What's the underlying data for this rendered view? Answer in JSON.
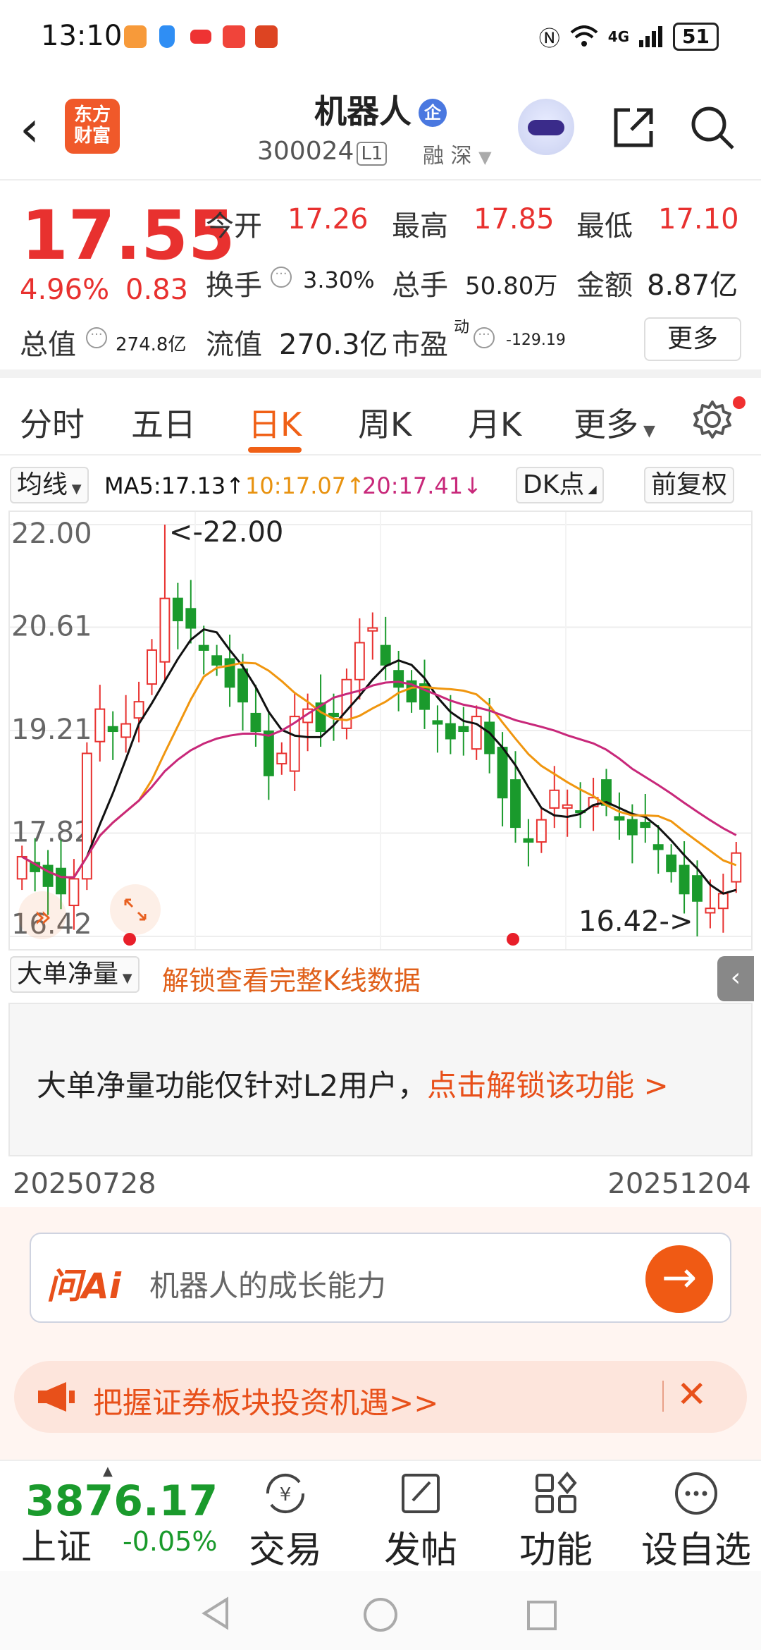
{
  "status_bar": {
    "time": "13:10",
    "network": "4G",
    "battery": "51"
  },
  "header": {
    "app_logo": "东方财富",
    "title": "机器人",
    "title_badge": "企",
    "code": "300024",
    "level_tag": "L1",
    "market_tags": "融 深"
  },
  "quote": {
    "price": "17.55",
    "change_pct": "4.96%",
    "change": "0.83",
    "open_label": "今开",
    "open": "17.26",
    "high_label": "最高",
    "high": "17.85",
    "low_label": "最低",
    "low": "17.10",
    "turnover_label": "换手",
    "turnover": "3.30%",
    "volume_label": "总手",
    "volume": "50.80万",
    "amount_label": "金额",
    "amount": "8.87亿",
    "mktcap_label": "总值",
    "mktcap": "274.8亿",
    "float_label": "流值",
    "float_cap": "270.3亿",
    "pe_label": "市盈",
    "pe_sup": "动",
    "pe": "-129.19",
    "more_label": "更多"
  },
  "tabs": [
    "分时",
    "五日",
    "日K",
    "周K",
    "月K",
    "更多"
  ],
  "active_tab": "日K",
  "ma_bar": {
    "selector": "均线",
    "ma5": "MA5:17.13",
    "ma10": "10:17.07",
    "ma20": "20:17.41",
    "dk": "DK点",
    "adjust": "前复权"
  },
  "colors": {
    "up": "#e8312f",
    "down": "#1a9a2c",
    "accent": "#f06016",
    "ma5": "#111111",
    "ma10": "#f0960f",
    "ma20": "#c8287a"
  },
  "chart_data": {
    "type": "candlestick",
    "y_ticks": [
      "22.00",
      "20.61",
      "19.21",
      "17.82",
      "16.42"
    ],
    "ylim": [
      16.42,
      22.0
    ],
    "annotations": {
      "max": "<-22.00",
      "min": "16.42->"
    },
    "start_date": "20250728",
    "end_date": "20251204",
    "ma5_label": "MA5",
    "ma10_label": "MA10",
    "ma20_label": "MA20",
    "ma5_last": 17.13,
    "ma10_last": 17.07,
    "ma20_last": 17.41,
    "close_samples": [
      17.5,
      17.3,
      17.1,
      17.0,
      17.2,
      18.9,
      19.5,
      19.2,
      19.3,
      19.6,
      20.3,
      21.0,
      20.7,
      20.6,
      20.3,
      20.1,
      19.8,
      19.6,
      19.2,
      18.6,
      18.9,
      19.4,
      19.5,
      19.2,
      19.4,
      19.9,
      20.4,
      20.6,
      20.1,
      19.8,
      19.6,
      19.5,
      19.3,
      19.1,
      19.2,
      19.4,
      18.9,
      18.3,
      17.9,
      17.7,
      18.0,
      18.4,
      18.2,
      18.1,
      18.3,
      18.2,
      18.0,
      17.8,
      17.9,
      17.6,
      17.3,
      17.0,
      16.9,
      16.8,
      17.0,
      17.55
    ]
  },
  "sub_panel": {
    "selector": "大单净量",
    "unlock_link": "解锁查看完整K线数据",
    "lock_text": "大单净量功能仅针对L2用户，",
    "lock_link": "点击解锁该功能 >"
  },
  "ai": {
    "logo": "问Ai",
    "placeholder": "机器人的成长能力"
  },
  "banner": {
    "text": "把握证券板块投资机遇>>"
  },
  "bottom_nav": {
    "index_value": "3876.17",
    "index_name": "上证",
    "index_change": "-0.05%",
    "trade": "交易",
    "post": "发帖",
    "functions": "功能",
    "watchlist": "设自选"
  }
}
